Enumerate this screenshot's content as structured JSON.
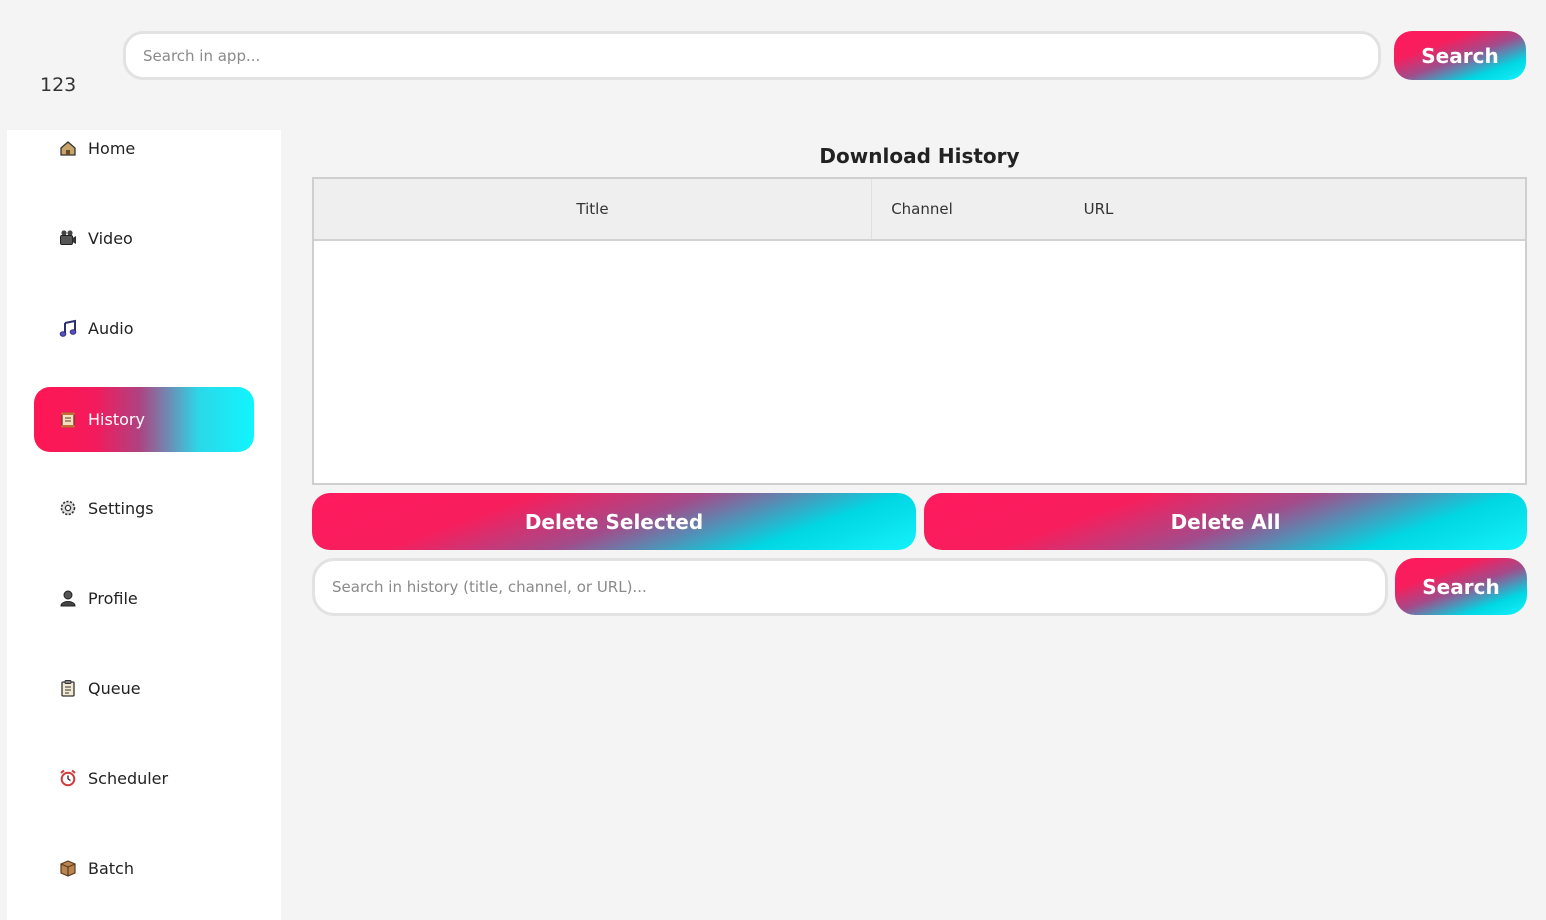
{
  "header": {
    "logo_text": "123",
    "search": {
      "placeholder": "Search in app...",
      "value": ""
    },
    "search_button_label": "Search"
  },
  "sidebar": {
    "items": [
      {
        "label": "Home",
        "icon": "home-icon"
      },
      {
        "label": "Video",
        "icon": "video-camera-icon"
      },
      {
        "label": "Audio",
        "icon": "music-note-icon"
      },
      {
        "label": "History",
        "icon": "scroll-icon",
        "active": true
      },
      {
        "label": "Settings",
        "icon": "gear-icon"
      },
      {
        "label": "Profile",
        "icon": "user-icon"
      },
      {
        "label": "Queue",
        "icon": "clipboard-icon"
      },
      {
        "label": "Scheduler",
        "icon": "alarm-clock-icon"
      },
      {
        "label": "Batch",
        "icon": "package-icon"
      }
    ]
  },
  "main": {
    "title": "Download History",
    "table": {
      "columns": [
        "Title",
        "Channel",
        "URL"
      ],
      "rows": []
    },
    "delete_selected_label": "Delete Selected",
    "delete_all_label": "Delete All",
    "history_search": {
      "placeholder": "Search in history (title, channel, or URL)...",
      "value": ""
    },
    "history_search_button_label": "Search"
  },
  "colors": {
    "gradient_pink": "#ff1a5e",
    "gradient_cyan": "#0ff6fe",
    "background": "#f4f4f4"
  }
}
